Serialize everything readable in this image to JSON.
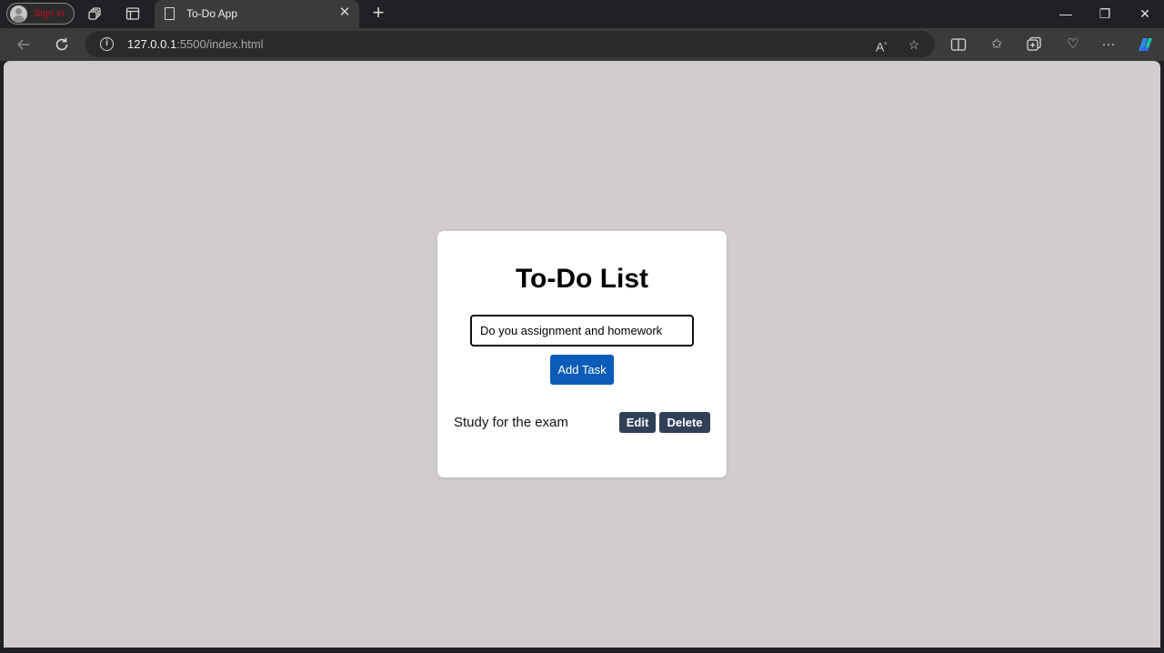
{
  "browser": {
    "profile_label": "Sign in",
    "tab_title": "To-Do App",
    "tab_close": "✕",
    "new_tab": "+",
    "url_host": "127.0.0.1",
    "url_rest": ":5500/index.html",
    "window_controls": {
      "minimize": "—",
      "restore": "❐",
      "close": "✕"
    },
    "icons": [
      "workspaces-icon",
      "tab-actions-icon",
      "page-icon",
      "back-arrow-icon",
      "refresh-icon",
      "info-icon",
      "read-aloud-icon",
      "favorite-star-icon",
      "split-screen-icon",
      "favorites-icon",
      "collections-icon",
      "browser-essentials-icon",
      "more-icon",
      "copilot-icon"
    ]
  },
  "app": {
    "heading": "To-Do List",
    "input_value": "Do you assignment and homework",
    "add_button": "Add Task",
    "tasks": [
      {
        "text": "Study for the exam",
        "edit_label": "Edit",
        "delete_label": "Delete"
      }
    ]
  },
  "colors": {
    "page_background": "#d0cdcc",
    "add_button": "#0b5bb8",
    "task_buttons": "#2f4058",
    "profile_label": "#c0111f"
  }
}
